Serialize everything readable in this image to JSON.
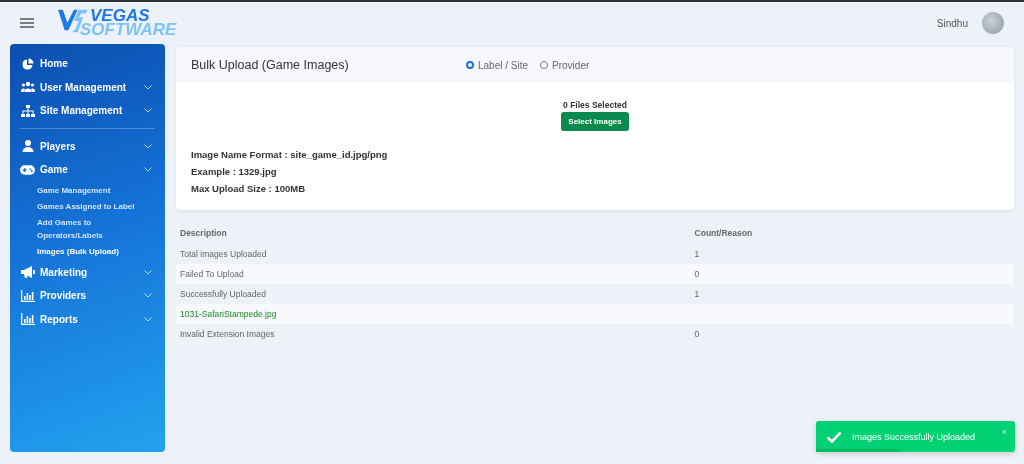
{
  "topbar": {
    "logo_top": "VEGAS",
    "logo_bottom": "SOFTWARE",
    "user": "Sindhu"
  },
  "sidebar": {
    "items": [
      {
        "kind": "link",
        "label": "Home"
      },
      {
        "kind": "group",
        "label": "User Management"
      },
      {
        "kind": "group",
        "label": "Site Management"
      },
      {
        "kind": "divider"
      },
      {
        "kind": "group",
        "label": "Players"
      },
      {
        "kind": "group",
        "label": "Game",
        "children": [
          {
            "label": "Game Management",
            "selected": false
          },
          {
            "label": "Games Assigned to Label",
            "selected": false
          },
          {
            "label": "Add Games to Operators/Labels",
            "selected": false
          },
          {
            "label": "Images (Bulk Upload)",
            "selected": true
          }
        ]
      },
      {
        "kind": "group",
        "label": "Marketing"
      },
      {
        "kind": "group",
        "label": "Providers"
      },
      {
        "kind": "group",
        "label": "Reports"
      }
    ]
  },
  "card": {
    "title": "Bulk Upload (Game Images)",
    "radios": [
      {
        "label": "Label / Site",
        "selected": true
      },
      {
        "label": "Provider",
        "selected": false
      }
    ],
    "files_selected": "0 Files Selected",
    "button": "Select Images",
    "info": [
      "Image Name Format : site_game_id.jpg/png",
      "Example : 1329.jpg",
      "Max Upload Size : 100MB"
    ]
  },
  "table": {
    "columns": [
      "Description",
      "Count/Reason"
    ],
    "rows": [
      {
        "kind": "plain",
        "cells": [
          "Total images Uploaded",
          "1"
        ]
      },
      {
        "kind": "plain",
        "cells": [
          "Failed To Upload",
          "0"
        ]
      },
      {
        "kind": "plain",
        "cells": [
          "Successfully Uploaded",
          "1"
        ]
      },
      {
        "kind": "file",
        "cells": [
          "1031-SafariStampede.jpg"
        ]
      },
      {
        "kind": "plain",
        "cells": [
          "Invalid Extension Images",
          "0"
        ]
      }
    ]
  },
  "toast": {
    "message": "Images Successfully Uploaded",
    "close": "×",
    "level": 0.42
  }
}
